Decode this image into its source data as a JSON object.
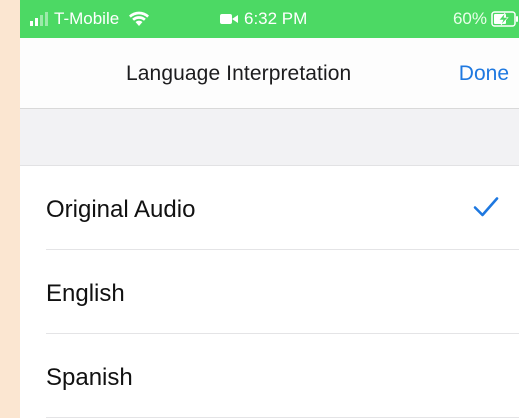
{
  "status_bar": {
    "carrier": "T-Mobile",
    "time": "6:32 PM",
    "battery": "60%",
    "icons": [
      "signal-icon",
      "wifi-icon",
      "camera-icon",
      "battery-charging-icon"
    ],
    "color": "#4cd964"
  },
  "nav": {
    "title": "Language Interpretation",
    "done_label": "Done",
    "accent_color": "#1e78e0"
  },
  "languages": {
    "items": [
      {
        "label": "Original Audio",
        "selected": true
      },
      {
        "label": "English",
        "selected": false
      },
      {
        "label": "Spanish",
        "selected": false
      }
    ],
    "check_icon": "checkmark-icon"
  }
}
